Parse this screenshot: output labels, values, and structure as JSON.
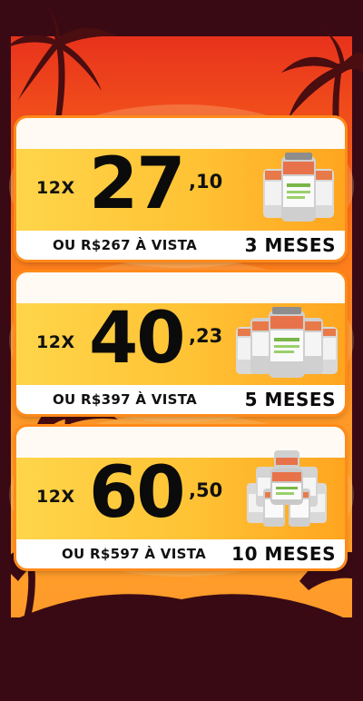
{
  "offers": [
    {
      "installments": "12X",
      "price_int": "27",
      "price_cents": ",10",
      "cash": "OU R$267 À VISTA",
      "months": "3 MESES",
      "bottle_count": 3
    },
    {
      "installments": "12X",
      "price_int": "40",
      "price_cents": ",23",
      "cash": "OU R$397 À VISTA",
      "months": "5 MESES",
      "bottle_count": 5
    },
    {
      "installments": "12X",
      "price_int": "60",
      "price_cents": ",50",
      "cash": "OU R$597 À VISTA",
      "months": "10 MESES",
      "bottle_count": 10
    }
  ],
  "colors": {
    "sky_top": "#e83a1c",
    "sky_mid": "#ff8c1a",
    "sky_bottom": "#ffb33a",
    "ground": "#3a0a14",
    "card": "#ffc234",
    "border": "#ff8a1a"
  }
}
